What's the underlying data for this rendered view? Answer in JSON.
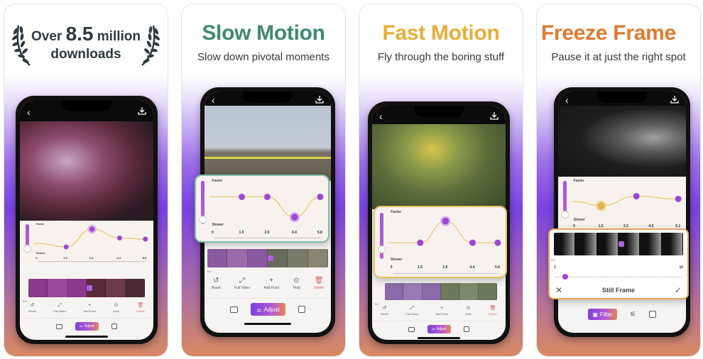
{
  "cards": [
    {
      "id": "downloads",
      "line1_prefix": "Over",
      "line1_number": "8.5",
      "line1_suffix": "million",
      "line2": "downloads",
      "graph": {
        "faster_label": "Faster",
        "slower_label": "Slower",
        "ticks": [
          "0",
          "1.5",
          "2.9",
          "4.4",
          "5.8"
        ],
        "points": [
          {
            "t": 0.0,
            "speed": 0.35
          },
          {
            "t": 1.5,
            "speed": 0.2
          },
          {
            "t": 2.9,
            "speed": 1.0
          },
          {
            "t": 4.4,
            "speed": 0.6
          },
          {
            "t": 5.8,
            "speed": 0.55
          }
        ],
        "selected_point": 2,
        "slider_level": 0.1
      },
      "time_start": "0.0",
      "toolbar": [
        "Reset",
        "Full Video",
        "Add Point",
        "Hold",
        "Delete"
      ],
      "nav_active": "Adjust"
    },
    {
      "id": "slow-motion",
      "title": "Slow Motion",
      "subtitle": "Slow down pivotal moments",
      "title_color": "#3f8a6e",
      "graph": {
        "faster_label": "Faster",
        "slower_label": "Slower",
        "ticks": [
          "0",
          "1.5",
          "2.9",
          "4.4",
          "5.8"
        ],
        "points": [
          {
            "t": 0.0,
            "speed": 0.75
          },
          {
            "t": 1.5,
            "speed": 0.75
          },
          {
            "t": 2.9,
            "speed": 0.75
          },
          {
            "t": 4.4,
            "speed": 0.1
          },
          {
            "t": 5.8,
            "speed": 0.75
          }
        ],
        "selected_point": 3,
        "slider_level": 0.1
      },
      "time_start": "0.0",
      "toolbar": [
        "Reset",
        "Full Video",
        "Add Point",
        "Hold",
        "Delete"
      ],
      "nav_active": "Adjust"
    },
    {
      "id": "fast-motion",
      "title": "Fast Motion",
      "subtitle": "Fly through the boring stuff",
      "title_color": "#e6ae3a",
      "graph": {
        "faster_label": "Faster",
        "slower_label": "Slower",
        "ticks": [
          "0",
          "1.5",
          "2.9",
          "4.4",
          "5.8"
        ],
        "points": [
          {
            "t": 0.0,
            "speed": 0.35
          },
          {
            "t": 1.5,
            "speed": 0.35
          },
          {
            "t": 2.9,
            "speed": 1.0
          },
          {
            "t": 4.4,
            "speed": 0.35
          },
          {
            "t": 5.8,
            "speed": 0.35
          }
        ],
        "selected_point": 2,
        "slider_level": 0.2
      },
      "time_start": "0.0",
      "toolbar": [
        "Reset",
        "Full Video",
        "Add Point",
        "Hold",
        "Delete"
      ],
      "nav_active": "Adjust"
    },
    {
      "id": "freeze-frame",
      "title": "Freeze Frame",
      "subtitle": "Pause it at just the right spot",
      "title_color": "#e07a2e",
      "graph": {
        "faster_label": "Faster",
        "slower_label": "Slower",
        "ticks": [
          "0",
          "1.5",
          "3.0",
          "4.5",
          "6.1"
        ],
        "points": [
          {
            "t": 0.0,
            "speed": 0.5
          },
          {
            "t": 1.5,
            "speed": 0.35
          },
          {
            "t": 3.6,
            "speed": 0.7
          },
          {
            "t": 6.1,
            "speed": 0.6
          }
        ],
        "selected_point": 1,
        "slider_level": 0.1
      },
      "time_start": "0.0",
      "still_frame": {
        "min_label": "1",
        "max_label": "10",
        "value": 1,
        "title": "Still Frame",
        "cancel_icon": "close-icon",
        "confirm_icon": "check-icon"
      },
      "nav_active": "Filter"
    }
  ],
  "icons": {
    "back": "‹",
    "reset": "↺",
    "full_video": "⤢",
    "add_point": "+",
    "hold": "⊙",
    "delete": "🗑",
    "adjust": "⚌",
    "filter": "▣",
    "sliders": "⚟",
    "edit": "✎"
  },
  "colors": {
    "accent_purple": "#8b45e0",
    "curve": "#e8c96a",
    "point": "#9b47d6"
  }
}
